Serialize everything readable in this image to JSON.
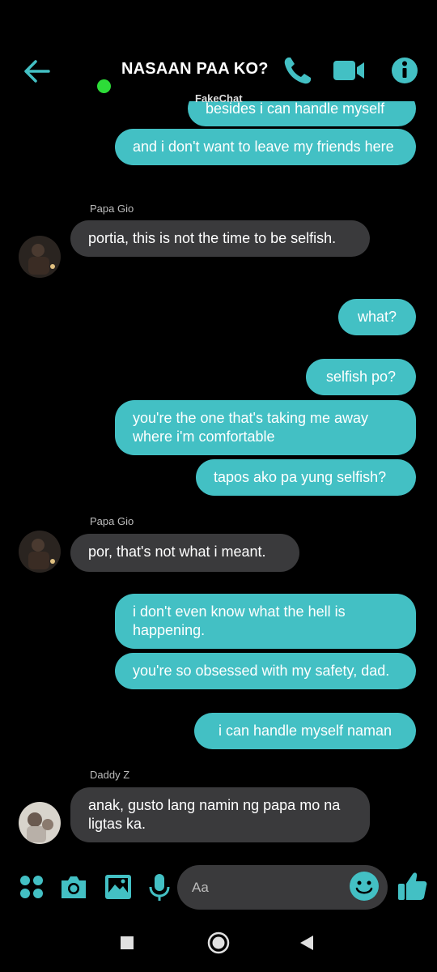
{
  "header": {
    "title": "NASAAN PAA KO?",
    "watermark": "FakeChat"
  },
  "messages": [
    {
      "id": "m0",
      "dir": "out",
      "text": "besides i can handle myself"
    },
    {
      "id": "m1",
      "dir": "out",
      "text": "and i don't want to leave my friends here"
    },
    {
      "id": "s1",
      "dir": "sender",
      "text": "Papa Gio"
    },
    {
      "id": "m2",
      "dir": "in",
      "text": "portia, this is not the time to be selfish."
    },
    {
      "id": "m3",
      "dir": "out",
      "text": "what?"
    },
    {
      "id": "m4",
      "dir": "out",
      "text": "selfish po?"
    },
    {
      "id": "m5",
      "dir": "out",
      "text": "you're the one that's taking me away where i'm comfortable"
    },
    {
      "id": "m6",
      "dir": "out",
      "text": "tapos ako pa yung selfish?"
    },
    {
      "id": "s2",
      "dir": "sender",
      "text": "Papa Gio"
    },
    {
      "id": "m7",
      "dir": "in",
      "text": "por, that's not what i meant."
    },
    {
      "id": "m8",
      "dir": "out",
      "text": "i don't even know what the hell is happening."
    },
    {
      "id": "m9",
      "dir": "out",
      "text": "you're so obsessed with my safety, dad."
    },
    {
      "id": "m10",
      "dir": "out",
      "text": "i can handle myself naman"
    },
    {
      "id": "s3",
      "dir": "sender",
      "text": "Daddy Z"
    },
    {
      "id": "m11",
      "dir": "in",
      "text": "anak, gusto lang namin ng papa mo na ligtas ka."
    }
  ],
  "composer": {
    "placeholder": "Aa",
    "icons": [
      "apps-icon",
      "camera-icon",
      "image-icon",
      "microphone-icon",
      "emoji-icon",
      "thumbs-up-icon"
    ]
  },
  "colors": {
    "accent": "#43c0c4",
    "outgoing_bubble": "#43c0c4",
    "incoming_bubble": "#3a3a3c",
    "online": "#2ddc38",
    "background": "#000000"
  }
}
